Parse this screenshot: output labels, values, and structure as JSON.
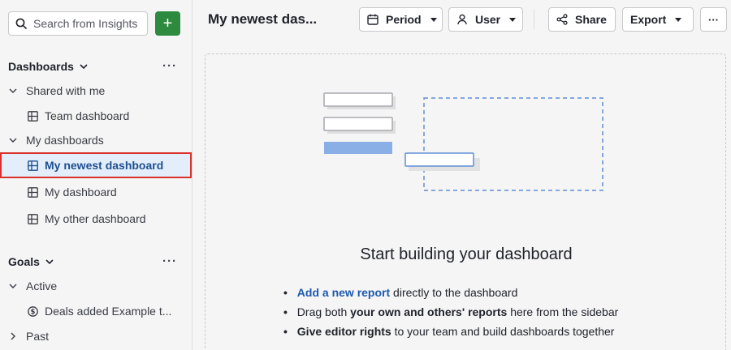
{
  "sidebar": {
    "search": {
      "placeholder": "Search from Insights"
    },
    "add_label": "+",
    "dashboards": {
      "title": "Dashboards",
      "more": "···",
      "groups": [
        {
          "label": "Shared with me",
          "items": [
            "Team dashboard"
          ]
        },
        {
          "label": "My dashboards",
          "items": [
            "My newest dashboard",
            "My dashboard",
            "My other dashboard"
          ]
        }
      ]
    },
    "goals": {
      "title": "Goals",
      "more": "···",
      "groups": [
        {
          "label": "Active",
          "items": [
            "Deals added Example t..."
          ]
        },
        {
          "label": "Past"
        }
      ]
    }
  },
  "header": {
    "title": "My newest das...",
    "period_label": "Period",
    "user_label": "User",
    "share_label": "Share",
    "export_label": "Export",
    "more_label": "···"
  },
  "empty_state": {
    "title": "Start building your dashboard",
    "bullets": [
      {
        "link": "Add a new report",
        "rest": " directly to the dashboard"
      },
      {
        "pre": "Drag both ",
        "bold": "your own and others' reports",
        "rest": " here from the sidebar"
      },
      {
        "bold": "Give editor rights",
        "rest": " to your team and build dashboards together"
      }
    ]
  },
  "colors": {
    "accent_green": "#2d8a3e",
    "active_bg": "#e4eefb",
    "active_text": "#1d4f91",
    "highlight_border": "#d9322b",
    "link": "#1d5ab0"
  }
}
